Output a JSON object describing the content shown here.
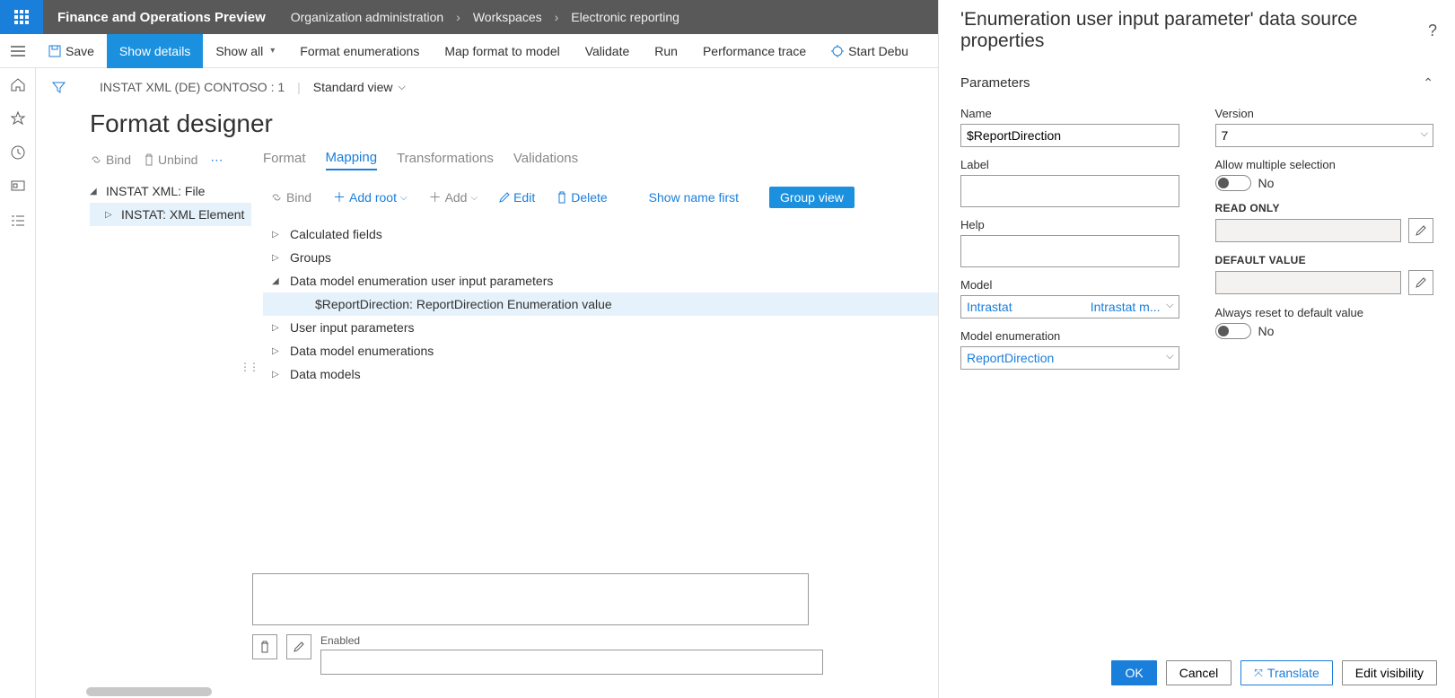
{
  "header": {
    "app_title": "Finance and Operations Preview",
    "breadcrumb": [
      "Organization administration",
      "Workspaces",
      "Electronic reporting"
    ]
  },
  "action_bar": {
    "save": "Save",
    "show_details": "Show details",
    "show_all": "Show all",
    "format_enumerations": "Format enumerations",
    "map_format": "Map format to model",
    "validate": "Validate",
    "run": "Run",
    "performance_trace": "Performance trace",
    "start_debug": "Start Debu"
  },
  "content": {
    "record_title": "INSTAT XML (DE) CONTOSO : 1",
    "view": "Standard view",
    "page_title": "Format designer",
    "bind_row": {
      "bind": "Bind",
      "unbind": "Unbind"
    },
    "left_tree": {
      "root": "INSTAT XML: File",
      "child": "INSTAT: XML Element"
    },
    "tabs": [
      "Format",
      "Mapping",
      "Transformations",
      "Validations"
    ],
    "map_toolbar": {
      "bind": "Bind",
      "add_root": "Add root",
      "add": "Add",
      "edit": "Edit",
      "delete": "Delete",
      "show_name_first": "Show name first",
      "group_view": "Group view"
    },
    "map_tree": [
      {
        "label": "Calculated fields",
        "indent": 1,
        "expanded": false
      },
      {
        "label": "Groups",
        "indent": 1,
        "expanded": false
      },
      {
        "label": "Data model enumeration user input parameters",
        "indent": 1,
        "expanded": true
      },
      {
        "label": "$ReportDirection: ReportDirection Enumeration value",
        "indent": 2,
        "selected": true
      },
      {
        "label": "User input parameters",
        "indent": 1,
        "expanded": false
      },
      {
        "label": "Data model enumerations",
        "indent": 1,
        "expanded": false
      },
      {
        "label": "Data models",
        "indent": 1,
        "expanded": false
      }
    ],
    "enabled_label": "Enabled"
  },
  "prop_panel": {
    "title": "'Enumeration user input parameter' data source properties",
    "section": "Parameters",
    "fields": {
      "name_label": "Name",
      "name_value": "$ReportDirection",
      "label_label": "Label",
      "label_value": "",
      "help_label": "Help",
      "help_value": "",
      "model_label": "Model",
      "model_value": "Intrastat",
      "model_module": "Intrastat m...",
      "model_enum_label": "Model enumeration",
      "model_enum_value": "ReportDirection",
      "version_label": "Version",
      "version_value": "7",
      "allow_multi_label": "Allow multiple selection",
      "allow_multi_value": "No",
      "readonly_label": "READ ONLY",
      "readonly_value": "",
      "default_label": "DEFAULT VALUE",
      "default_value": "",
      "always_reset_label": "Always reset to default value",
      "always_reset_value": "No"
    },
    "footer": {
      "ok": "OK",
      "cancel": "Cancel",
      "translate": "Translate",
      "edit_visibility": "Edit visibility"
    }
  }
}
